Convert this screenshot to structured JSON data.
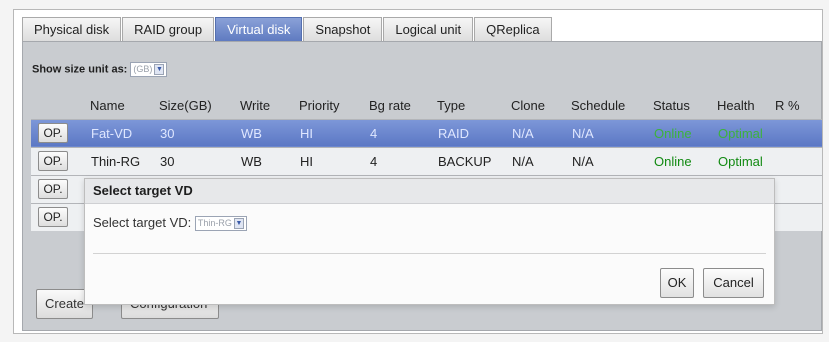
{
  "tabs": [
    {
      "label": "Physical disk"
    },
    {
      "label": "RAID group"
    },
    {
      "label": "Virtual disk",
      "active": true
    },
    {
      "label": "Snapshot"
    },
    {
      "label": "Logical unit"
    },
    {
      "label": "QReplica"
    }
  ],
  "size_unit": {
    "label": "Show size unit as:",
    "value": "(GB)"
  },
  "table": {
    "headers": [
      "Name",
      "Size(GB)",
      "Write",
      "Priority",
      "Bg rate",
      "Type",
      "Clone",
      "Schedule",
      "Status",
      "Health",
      "R %"
    ],
    "rows": [
      {
        "op": "OP.",
        "name": "Fat-VD",
        "size": "30",
        "write": "WB",
        "priority": "HI",
        "bg_rate": "4",
        "type": "RAID",
        "clone": "N/A",
        "schedule": "N/A",
        "status": "Online",
        "health": "Optimal",
        "r": ""
      },
      {
        "op": "OP.",
        "name": "Thin-RG",
        "size": "30",
        "write": "WB",
        "priority": "HI",
        "bg_rate": "4",
        "type": "BACKUP",
        "clone": "N/A",
        "schedule": "N/A",
        "status": "Online",
        "health": "Optimal",
        "r": ""
      },
      {
        "op": "OP."
      },
      {
        "op": "OP."
      }
    ]
  },
  "bottom_buttons": {
    "create": "Create",
    "configuration": "Configuration"
  },
  "dialog": {
    "title": "Select target VD",
    "field_label": "Select target VD:",
    "field_value": "Thin-RG",
    "ok": "OK",
    "cancel": "Cancel"
  },
  "colors": {
    "selected_row": "#6a86cf",
    "status_green": "#128a12",
    "active_tab": "#6f89cc"
  }
}
